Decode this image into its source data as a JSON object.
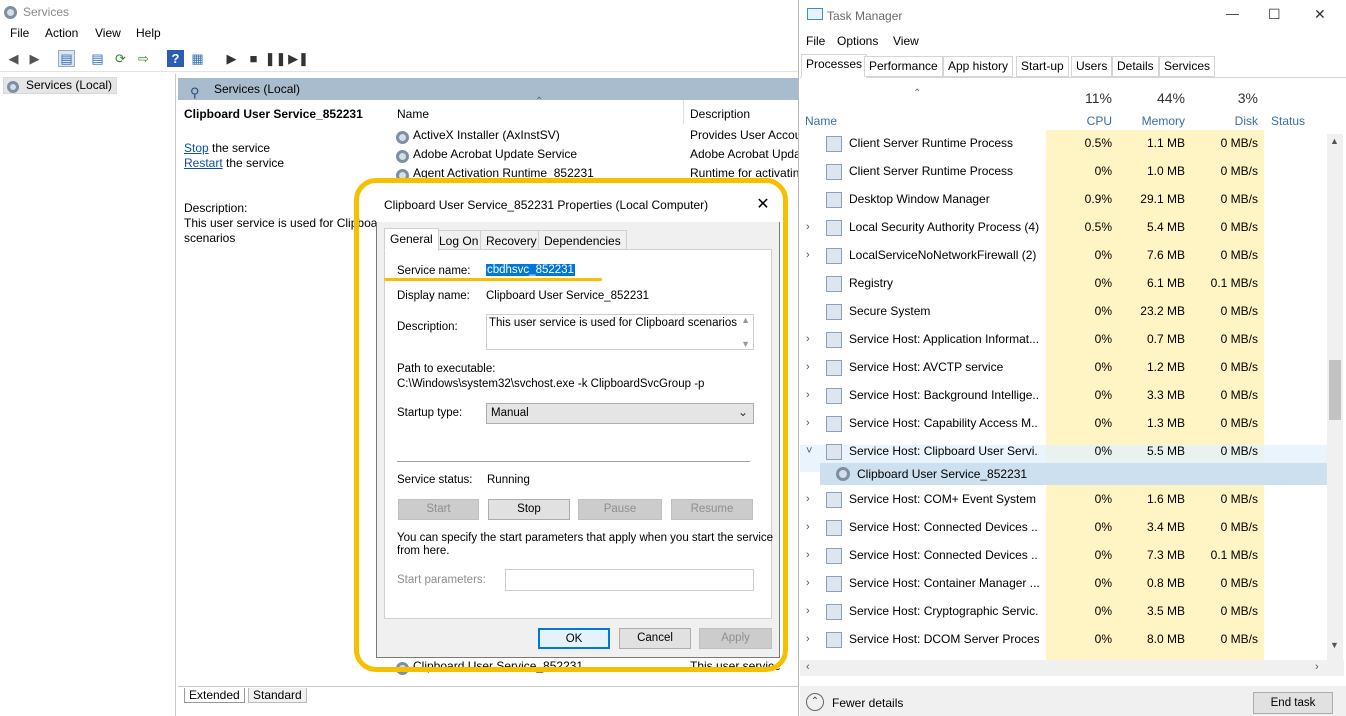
{
  "services_window": {
    "title": "Services",
    "menu": [
      "File",
      "Action",
      "View",
      "Help"
    ],
    "tree_item": "Services (Local)",
    "pane_header": "Services (Local)",
    "selected_service": "Clipboard User Service_852231",
    "stop_link": "Stop",
    "stop_suffix": " the service",
    "restart_link": "Restart",
    "restart_suffix": " the service",
    "description_label": "Description:",
    "description_text": "This user service is used for Clipboard scenarios",
    "description_visible_1": "This user service is used for Clipboar",
    "description_visible_2": "scenarios",
    "columns": {
      "name": "Name",
      "description": "Description"
    },
    "rows": [
      {
        "name": "ActiveX Installer (AxInstSV)",
        "desc": "Provides User Accou"
      },
      {
        "name": "Adobe Acrobat Update Service",
        "desc": "Adobe Acrobat Upda"
      },
      {
        "name": "Agent Activation Runtime_852231",
        "desc": "Runtime for activatin"
      }
    ],
    "bottom_rows": [
      {
        "name": "Clipboard User Service_852231",
        "desc": "This user service"
      }
    ],
    "tabs": [
      "Extended",
      "Standard"
    ]
  },
  "dialog": {
    "title": "Clipboard User Service_852231 Properties (Local Computer)",
    "tabs": [
      "General",
      "Log On",
      "Recovery",
      "Dependencies"
    ],
    "service_name_label": "Service name:",
    "service_name_value": "cbdhsvc_852231",
    "display_name_label": "Display name:",
    "display_name_value": "Clipboard User Service_852231",
    "description_label": "Description:",
    "description_value": "This user service is used for Clipboard scenarios",
    "path_label": "Path to executable:",
    "path_value": "C:\\Windows\\system32\\svchost.exe -k ClipboardSvcGroup -p",
    "startup_label": "Startup type:",
    "startup_value": "Manual",
    "status_label": "Service status:",
    "status_value": "Running",
    "buttons": {
      "start": "Start",
      "stop": "Stop",
      "pause": "Pause",
      "resume": "Resume"
    },
    "hint": "You can specify the start parameters that apply when you start the service from here.",
    "hint_line1": "You can specify the start parameters that apply when you start the service",
    "hint_line2": "from here.",
    "params_label": "Start parameters:",
    "ok": "OK",
    "cancel": "Cancel",
    "apply": "Apply"
  },
  "task_manager": {
    "title": "Task Manager",
    "menu": [
      "File",
      "Options",
      "View"
    ],
    "tabs": [
      "Processes",
      "Performance",
      "App history",
      "Start-up",
      "Users",
      "Details",
      "Services"
    ],
    "columns": {
      "name": "Name",
      "cpu_pct": "11%",
      "cpu": "CPU",
      "mem_pct": "44%",
      "mem": "Memory",
      "disk_pct": "3%",
      "disk": "Disk",
      "status": "Status"
    },
    "processes": [
      {
        "name": "Client Server Runtime Process",
        "cpu": "0.5%",
        "mem": "1.1 MB",
        "disk": "0 MB/s",
        "expand": false
      },
      {
        "name": "Client Server Runtime Process",
        "cpu": "0%",
        "mem": "1.0 MB",
        "disk": "0 MB/s",
        "expand": false
      },
      {
        "name": "Desktop Window Manager",
        "cpu": "0.9%",
        "mem": "29.1 MB",
        "disk": "0 MB/s",
        "expand": false
      },
      {
        "name": "Local Security Authority Process (4)",
        "cpu": "0.5%",
        "mem": "5.4 MB",
        "disk": "0 MB/s",
        "expand": true
      },
      {
        "name": "LocalServiceNoNetworkFirewall (2)",
        "cpu": "0%",
        "mem": "7.6 MB",
        "disk": "0 MB/s",
        "expand": true
      },
      {
        "name": "Registry",
        "cpu": "0%",
        "mem": "6.1 MB",
        "disk": "0.1 MB/s",
        "expand": false
      },
      {
        "name": "Secure System",
        "cpu": "0%",
        "mem": "23.2 MB",
        "disk": "0 MB/s",
        "expand": false
      },
      {
        "name": "Service Host: Application Informat...",
        "cpu": "0%",
        "mem": "0.7 MB",
        "disk": "0 MB/s",
        "expand": true
      },
      {
        "name": "Service Host: AVCTP service",
        "cpu": "0%",
        "mem": "1.2 MB",
        "disk": "0 MB/s",
        "expand": true
      },
      {
        "name": "Service Host: Background Intellige...",
        "cpu": "0%",
        "mem": "3.3 MB",
        "disk": "0 MB/s",
        "expand": true
      },
      {
        "name": "Service Host: Capability Access M...",
        "cpu": "0%",
        "mem": "1.3 MB",
        "disk": "0 MB/s",
        "expand": true
      },
      {
        "name": "Service Host: Clipboard User Servi...",
        "cpu": "0%",
        "mem": "5.5 MB",
        "disk": "0 MB/s",
        "expand": true
      }
    ],
    "child_process": "Clipboard User Service_852231",
    "processes_after": [
      {
        "name": "Service Host: COM+ Event System",
        "cpu": "0%",
        "mem": "1.6 MB",
        "disk": "0 MB/s"
      },
      {
        "name": "Service Host: Connected Devices ...",
        "cpu": "0%",
        "mem": "3.4 MB",
        "disk": "0 MB/s"
      },
      {
        "name": "Service Host: Connected Devices ...",
        "cpu": "0%",
        "mem": "7.3 MB",
        "disk": "0.1 MB/s"
      },
      {
        "name": "Service Host: Container Manager ...",
        "cpu": "0%",
        "mem": "0.8 MB",
        "disk": "0 MB/s"
      },
      {
        "name": "Service Host: Cryptographic Servic...",
        "cpu": "0%",
        "mem": "3.5 MB",
        "disk": "0 MB/s"
      },
      {
        "name": "Service Host: DCOM Server Proces...",
        "cpu": "0%",
        "mem": "8.0 MB",
        "disk": "0 MB/s"
      }
    ],
    "fewer_details": "Fewer details",
    "end_task": "End task"
  },
  "colors": {
    "highlight": "#f6c000",
    "selection": "#0078d7",
    "cpu_bg": "#fff4c4"
  }
}
